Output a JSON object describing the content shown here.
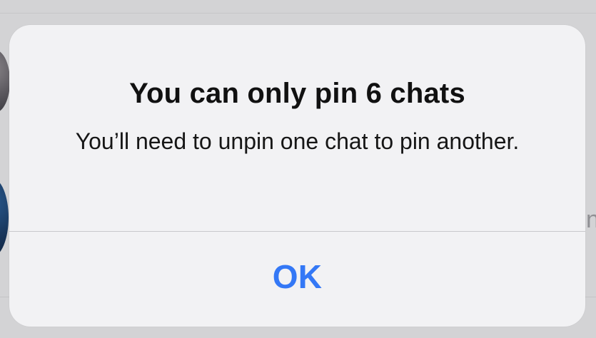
{
  "background": {
    "partial_text": "n"
  },
  "alert": {
    "title": "You can only pin 6 chats",
    "message": "You’ll need to unpin one chat to pin another.",
    "button": {
      "label": "OK"
    }
  },
  "colors": {
    "accent": "#3478F6",
    "alert_background": "#F2F2F4",
    "screen_background": "#D3D3D5"
  }
}
